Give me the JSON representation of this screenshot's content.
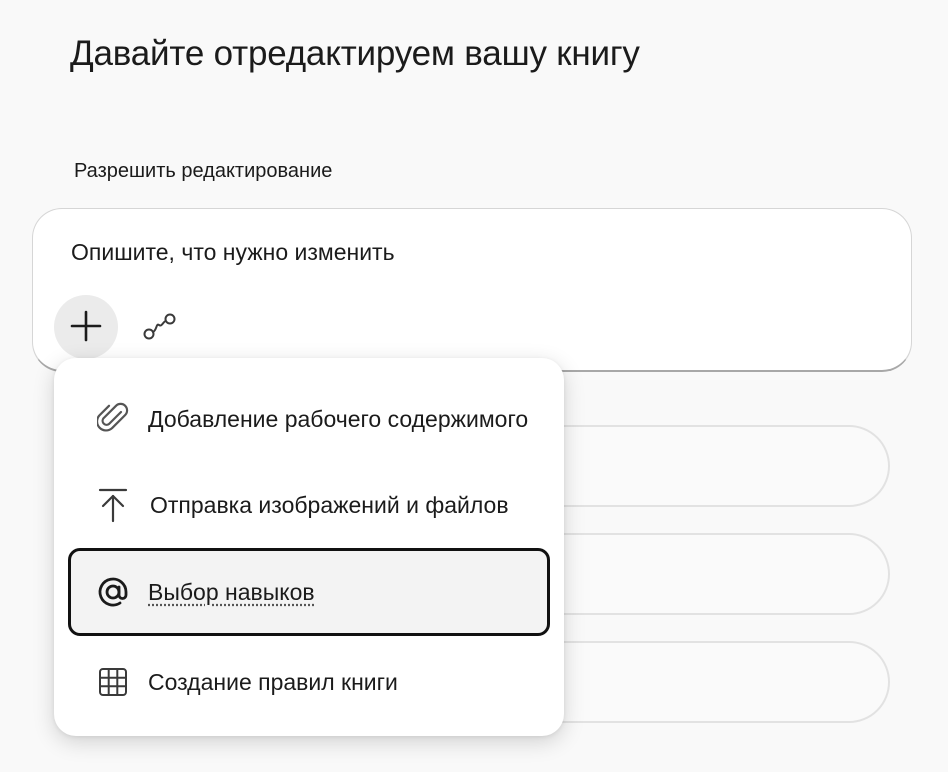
{
  "page": {
    "title": "Давайте отредактируем вашу книгу",
    "section_label": "Разрешить редактирование"
  },
  "prompt": {
    "placeholder": "Опишите, что нужно изменить",
    "value": "",
    "add_button_icon": "plus-icon",
    "connect_button_icon": "connector-icon"
  },
  "menu": {
    "items": [
      {
        "label": "Добавление рабочего содержимого",
        "icon": "paperclip-icon",
        "focused": false
      },
      {
        "label": "Отправка изображений и файлов",
        "icon": "upload-icon",
        "focused": false
      },
      {
        "label": "Выбор навыков",
        "icon": "at-sign-icon",
        "focused": true
      },
      {
        "label": "Создание правил книги",
        "icon": "grid-icon",
        "focused": false
      }
    ]
  },
  "colors": {
    "background": "#f9f9f9",
    "surface": "#ffffff",
    "text": "#1b1b1b",
    "focus_border": "#111111",
    "button_fill": "#ebebeb"
  }
}
